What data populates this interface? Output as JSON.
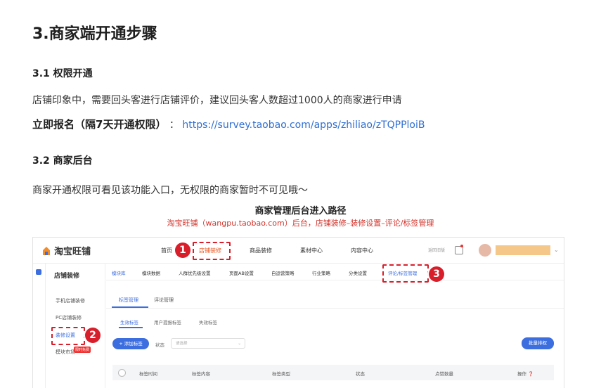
{
  "doc": {
    "h1": "3.商家端开通步骤",
    "sec1": {
      "heading": "3.1 权限开通",
      "para": "店铺印象中，需要回头客进行店铺评价，建议回头客人数超过1000人的商家进行申请",
      "signup_label": "立即报名（隔7天开通权限）",
      "signup_sep": "：",
      "signup_link": "https://survey.taobao.com/apps/zhiliao/zTQPPloiB"
    },
    "sec2": {
      "heading": "3.2 商家后台",
      "para": "商家开通权限可看见该功能入口，无权限的商家暂时不可见哦～"
    }
  },
  "figure": {
    "title": "商家管理后台进入路径",
    "subtitle": "淘宝旺铺（wangpu.taobao.com）后台，店铺装修–装修设置–评论/标签管理",
    "logo": "淘宝旺铺",
    "nav": [
      "首页",
      "店铺装修",
      "商品装修",
      "素材中心",
      "内容中心"
    ],
    "util_text": "返回旧版",
    "sidebar": {
      "title": "店铺装修",
      "items": [
        "手机店铺装修",
        "PC店铺装修",
        "装修设置",
        "模块市场"
      ],
      "hot": "限时免费"
    },
    "tabs1": [
      "模块库",
      "模块数据",
      "人群优先级设置",
      "页面AB设置",
      "自运营策略",
      "行业策略",
      "分类设置",
      "评论/标签管理"
    ],
    "tabs2": [
      "标签管理",
      "评论管理"
    ],
    "tabs3": [
      "生效标签",
      "用户提报标签",
      "失效标签"
    ],
    "add_btn": "+ 添加标签",
    "status_label": "状态",
    "select_placeholder": "请选择",
    "batch_btn": "批量排权",
    "table_headers": [
      "标签时间",
      "标签内容",
      "标签类型",
      "状态",
      "点赞数量",
      "操作 ❓"
    ],
    "steps": [
      "1",
      "2",
      "3"
    ],
    "colors": {
      "accent": "#3c6ee0",
      "marker": "#d81e2a",
      "link": "#2f6fd1"
    }
  }
}
